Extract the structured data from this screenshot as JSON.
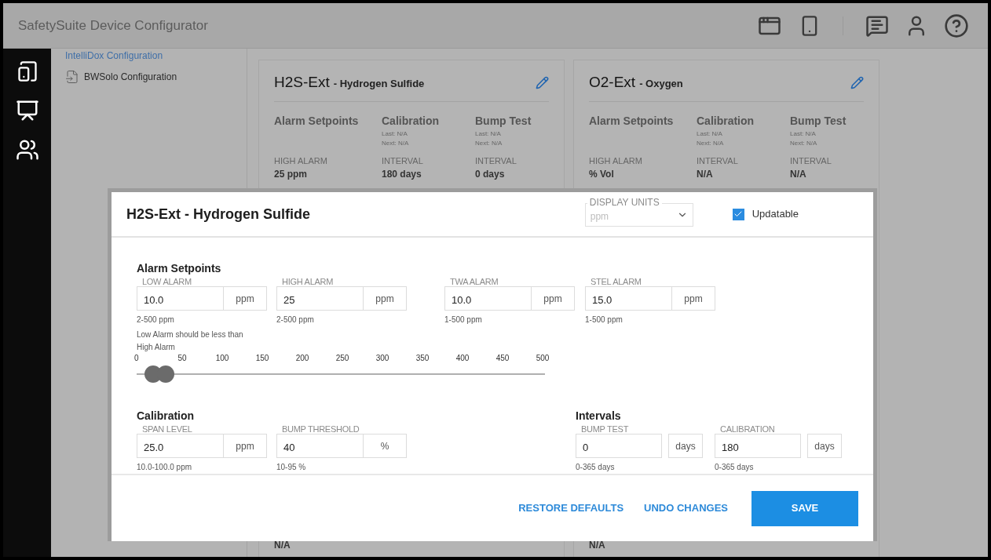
{
  "app": {
    "title": "SafetySuite Device Configurator"
  },
  "nav": [
    {
      "label": "IntelliDox Configuration",
      "kind": "link"
    },
    {
      "label": "BWSolo Configuration",
      "kind": "file"
    }
  ],
  "cards": [
    {
      "name": "H2S-Ext",
      "subtitle": "- Hydrogen Sulfide",
      "columns": [
        {
          "title": "Alarm Setpoints",
          "label": "HIGH ALARM",
          "value": "25 ppm"
        },
        {
          "title": "Calibration",
          "notes": [
            "Last: N/A",
            "Next: N/A"
          ],
          "label": "INTERVAL",
          "value": "180 days"
        },
        {
          "title": "Bump Test",
          "notes": [
            "Last: N/A",
            "Next: N/A"
          ],
          "label": "INTERVAL",
          "value": "0 days"
        }
      ],
      "bottom_value": "N/A"
    },
    {
      "name": "O2-Ext",
      "subtitle": "- Oxygen",
      "columns": [
        {
          "title": "Alarm Setpoints",
          "label": "HIGH ALARM",
          "value": "% Vol"
        },
        {
          "title": "Calibration",
          "notes": [
            "Last: N/A",
            "Next: N/A"
          ],
          "label": "INTERVAL",
          "value": "N/A"
        },
        {
          "title": "Bump Test",
          "notes": [
            "Last: N/A",
            "Next: N/A"
          ],
          "label": "INTERVAL",
          "value": "N/A"
        }
      ],
      "bottom_value": "N/A"
    }
  ],
  "dialog": {
    "title": "H2S-Ext - Hydrogen Sulfide",
    "display_units": {
      "label": "DISPLAY UNITS",
      "value": "ppm",
      "disabled": true
    },
    "updatable": {
      "label": "Updatable",
      "checked": true
    },
    "alarm_setpoints": {
      "title": "Alarm Setpoints",
      "fields": [
        {
          "label": "LOW ALARM",
          "value": "10.0",
          "unit": "ppm",
          "hint": "2-500 ppm",
          "note": "Low Alarm should be less than High Alarm"
        },
        {
          "label": "HIGH ALARM",
          "value": "25",
          "unit": "ppm",
          "hint": "2-500 ppm"
        },
        {
          "label": "TWA ALARM",
          "value": "10.0",
          "unit": "ppm",
          "hint": "1-500 ppm"
        },
        {
          "label": "STEL ALARM",
          "value": "15.0",
          "unit": "ppm",
          "hint": "1-500 ppm"
        }
      ]
    },
    "slider": {
      "ticks": [
        "0",
        "50",
        "100",
        "150",
        "200",
        "250",
        "300",
        "350",
        "400",
        "450",
        "500"
      ],
      "thumbs": [
        {
          "level": 0.02
        },
        {
          "level": 0.05
        }
      ]
    },
    "calibration": {
      "title": "Calibration",
      "fields": [
        {
          "label": "SPAN LEVEL",
          "value": "25.0",
          "unit": "ppm",
          "hint": "10.0-100.0 ppm"
        },
        {
          "label": "BUMP THRESHOLD",
          "value": "40",
          "unit": "%",
          "hint": "10-95 %"
        }
      ]
    },
    "intervals": {
      "title": "Intervals",
      "fields": [
        {
          "label": "BUMP TEST",
          "value": "0",
          "unit": "days",
          "hint": "0-365 days"
        },
        {
          "label": "CALIBRATION",
          "value": "180",
          "unit": "days",
          "hint": "0-365 days"
        }
      ]
    },
    "actions": [
      {
        "label": "RESTORE DEFAULTS",
        "kind": "link"
      },
      {
        "label": "UNDO CHANGES",
        "kind": "link"
      },
      {
        "label": "SAVE",
        "kind": "primary"
      }
    ]
  }
}
